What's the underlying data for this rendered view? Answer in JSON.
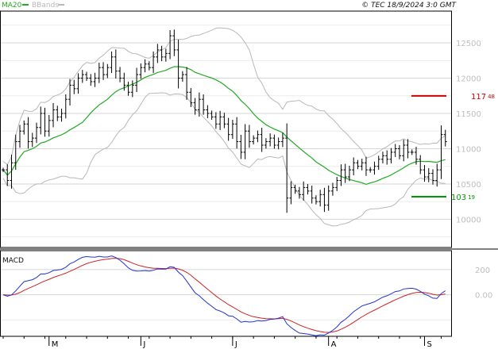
{
  "header": {
    "legend_ma": "MA20",
    "legend_bb": "BBands",
    "copyright": "© TEC 18/9/2024 3:0 GMT"
  },
  "colors": {
    "ma": "#22aa22",
    "bbands": "#b8b8b8",
    "macd_line": "#2233cc",
    "macd_signal": "#cc2222",
    "resistance": "#cc0000",
    "support": "#009900",
    "grid": "#d6d6d6",
    "frame": "#000000"
  },
  "chart_data": [
    {
      "type": "ohlc",
      "series": [
        {
          "name": "MA20"
        },
        {
          "name": "BBands"
        }
      ],
      "y_ticks": [
        10000,
        10500,
        11000,
        11500,
        12000,
        12500
      ],
      "ylim": [
        9600,
        12950
      ],
      "x_month_labels": [
        {
          "label": "M",
          "index": 11
        },
        {
          "label": "J",
          "index": 33
        },
        {
          "label": "J",
          "index": 55
        },
        {
          "label": "A",
          "index": 78
        },
        {
          "label": "S",
          "index": 101
        }
      ],
      "n_bars": 112,
      "closes": [
        10700,
        10550,
        10800,
        11100,
        11250,
        11350,
        11100,
        11150,
        11300,
        11500,
        11250,
        11400,
        11550,
        11450,
        11500,
        11700,
        11900,
        11850,
        12000,
        12050,
        12000,
        11950,
        12000,
        12150,
        12050,
        12150,
        12300,
        12100,
        12000,
        11900,
        11800,
        11900,
        12050,
        12150,
        12200,
        12150,
        12300,
        12400,
        12300,
        12350,
        12600,
        12400,
        12000,
        12050,
        11800,
        11650,
        11550,
        11700,
        11550,
        11500,
        11450,
        11350,
        11450,
        11350,
        11200,
        11350,
        11100,
        10950,
        11250,
        11100,
        11150,
        11200,
        11050,
        11100,
        11150,
        11050,
        11100,
        11150,
        10300,
        10450,
        10400,
        10350,
        10450,
        10400,
        10300,
        10250,
        10350,
        10200,
        10400,
        10450,
        10550,
        10700,
        10600,
        10700,
        10800,
        10750,
        10800,
        10700,
        10700,
        10750,
        10850,
        10900,
        10850,
        10950,
        11000,
        10900,
        11050,
        10950,
        10950,
        10850,
        10700,
        10600,
        10650,
        10550,
        10700,
        11200,
        11100
      ]
    },
    {
      "type": "line",
      "title": "MACD",
      "y_ticks": [
        0,
        200
      ],
      "ylim": [
        -330,
        350
      ]
    }
  ],
  "price_lines": {
    "resistance": {
      "value": 11748,
      "label_main": "117",
      "label_sup": "48"
    },
    "support": {
      "value": 10319,
      "label_main": "103",
      "label_sup": "19"
    }
  }
}
